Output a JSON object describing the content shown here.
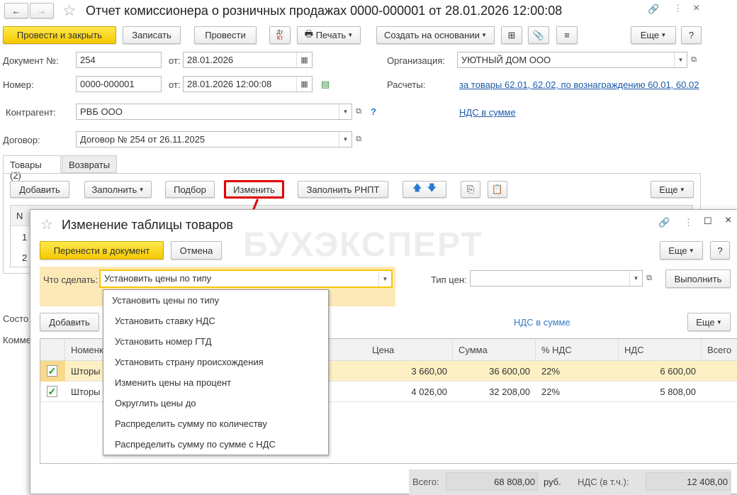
{
  "window": {
    "title": "Отчет комиссионера о розничных продажах 0000-000001 от 28.01.2026 12:00:08"
  },
  "toolbar": {
    "post_close": "Провести и закрыть",
    "save": "Записать",
    "post": "Провести",
    "dtkt_top": "Дт",
    "dtkt_bottom": "Кт",
    "print": "Печать",
    "create_based": "Создать на основании",
    "more": "Еще",
    "help": "?"
  },
  "form": {
    "doc_no_label": "Документ №:",
    "doc_no": "254",
    "from_label": "от:",
    "doc_date": "28.01.2026",
    "number_label": "Номер:",
    "number": "0000-000001",
    "from_label2": "от:",
    "number_date": "28.01.2026 12:00:08",
    "org_label": "Организация:",
    "org": "УЮТНЫЙ ДОМ ООО",
    "calc_label": "Расчеты:",
    "calc_link": "за товары 62.01, 62.02, по вознаграждению 60.01, 60.02",
    "contractor_label": "Контрагент:",
    "contractor": "РВБ ООО",
    "help_q": "?",
    "vat_link": "НДС в сумме",
    "contract_label": "Договор:",
    "contract": "Договор № 254 от 26.11.2025",
    "status_label": "Состо",
    "comment_label": "Комме"
  },
  "tabs": [
    {
      "label": "Товары (2)"
    },
    {
      "label": "Возвраты"
    }
  ],
  "goods_toolbar": {
    "add": "Добавить",
    "fill": "Заполнить",
    "pick": "Подбор",
    "change": "Изменить",
    "fill_rnpt": "Заполнить РНПТ",
    "more": "Еще"
  },
  "bg_table": {
    "n_header": "N",
    "rows": [
      "1",
      "2"
    ]
  },
  "dialog": {
    "title": "Изменение таблицы товаров",
    "watermark": "БУХЭКСПЕРТ",
    "transfer": "Перенести в документ",
    "cancel": "Отмена",
    "more": "Еще",
    "help": "?",
    "action_label": "Что сделать:",
    "action_value": "Установить цены по типу",
    "price_type_label": "Тип цен:",
    "price_type_value": "",
    "execute": "Выполнить",
    "add": "Добавить",
    "vat_link": "НДС в сумме",
    "more2": "Еще",
    "menu": [
      "Установить цены по типу",
      "Установить ставку НДС",
      "Установить номер ГТД",
      "Установить страну происхождения",
      "Изменить цены на процент",
      "Округлить цены до",
      "Распределить сумму по количеству",
      "Распределить сумму по сумме с НДС"
    ],
    "columns": {
      "nomen": "Номенк",
      "price": "Цена",
      "sum": "Сумма",
      "vat_rate": "% НДС",
      "vat": "НДС",
      "total": "Всего"
    },
    "rows": [
      {
        "checked": true,
        "nomen": "Шторы",
        "price": "3 660,00",
        "sum": "36 600,00",
        "vat_rate": "22%",
        "vat": "6 600,00"
      },
      {
        "checked": true,
        "nomen": "Шторы",
        "price": "4 026,00",
        "sum": "32 208,00",
        "vat_rate": "22%",
        "vat": "5 808,00"
      }
    ],
    "footer": {
      "total_label": "Всего:",
      "total": "68 808,00",
      "currency": "руб.",
      "vat_label": "НДС (в т.ч.):",
      "vat": "12 408,00"
    }
  },
  "colors": {
    "accent_yellow": "#f5c800",
    "highlight": "#fdf0c4",
    "red": "#e00000",
    "link": "#1a5aa8"
  }
}
